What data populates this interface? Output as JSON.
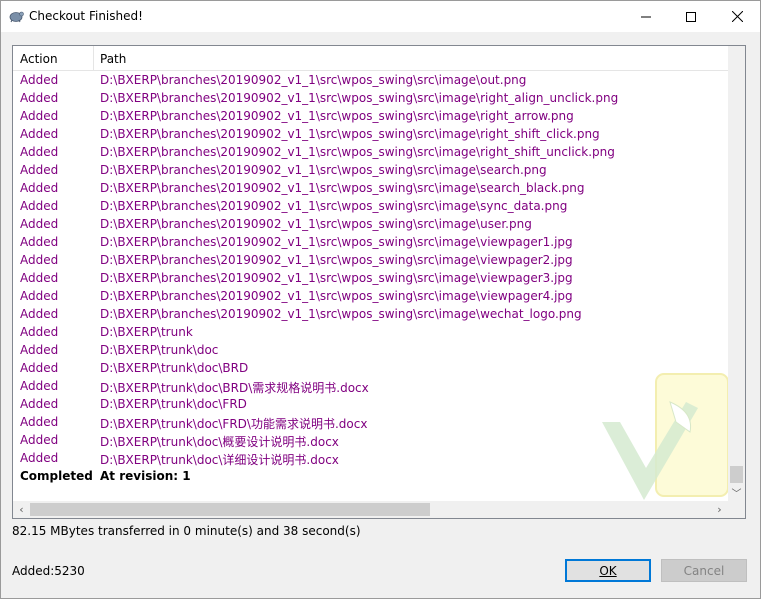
{
  "window": {
    "title": "Checkout Finished!",
    "minimize_glyph": "—",
    "maximize_glyph": "☐",
    "close_glyph": "✕"
  },
  "list": {
    "columns": {
      "action": "Action",
      "path": "Path"
    },
    "rows": [
      {
        "action": "Added",
        "path": "D:\\BXERP\\branches\\20190902_v1_1\\src\\wpos_swing\\src\\image\\out.png"
      },
      {
        "action": "Added",
        "path": "D:\\BXERP\\branches\\20190902_v1_1\\src\\wpos_swing\\src\\image\\right_align_unclick.png"
      },
      {
        "action": "Added",
        "path": "D:\\BXERP\\branches\\20190902_v1_1\\src\\wpos_swing\\src\\image\\right_arrow.png"
      },
      {
        "action": "Added",
        "path": "D:\\BXERP\\branches\\20190902_v1_1\\src\\wpos_swing\\src\\image\\right_shift_click.png"
      },
      {
        "action": "Added",
        "path": "D:\\BXERP\\branches\\20190902_v1_1\\src\\wpos_swing\\src\\image\\right_shift_unclick.png"
      },
      {
        "action": "Added",
        "path": "D:\\BXERP\\branches\\20190902_v1_1\\src\\wpos_swing\\src\\image\\search.png"
      },
      {
        "action": "Added",
        "path": "D:\\BXERP\\branches\\20190902_v1_1\\src\\wpos_swing\\src\\image\\search_black.png"
      },
      {
        "action": "Added",
        "path": "D:\\BXERP\\branches\\20190902_v1_1\\src\\wpos_swing\\src\\image\\sync_data.png"
      },
      {
        "action": "Added",
        "path": "D:\\BXERP\\branches\\20190902_v1_1\\src\\wpos_swing\\src\\image\\user.png"
      },
      {
        "action": "Added",
        "path": "D:\\BXERP\\branches\\20190902_v1_1\\src\\wpos_swing\\src\\image\\viewpager1.jpg"
      },
      {
        "action": "Added",
        "path": "D:\\BXERP\\branches\\20190902_v1_1\\src\\wpos_swing\\src\\image\\viewpager2.jpg"
      },
      {
        "action": "Added",
        "path": "D:\\BXERP\\branches\\20190902_v1_1\\src\\wpos_swing\\src\\image\\viewpager3.jpg"
      },
      {
        "action": "Added",
        "path": "D:\\BXERP\\branches\\20190902_v1_1\\src\\wpos_swing\\src\\image\\viewpager4.jpg"
      },
      {
        "action": "Added",
        "path": "D:\\BXERP\\branches\\20190902_v1_1\\src\\wpos_swing\\src\\image\\wechat_logo.png"
      },
      {
        "action": "Added",
        "path": "D:\\BXERP\\trunk"
      },
      {
        "action": "Added",
        "path": "D:\\BXERP\\trunk\\doc"
      },
      {
        "action": "Added",
        "path": "D:\\BXERP\\trunk\\doc\\BRD"
      },
      {
        "action": "Added",
        "path": "D:\\BXERP\\trunk\\doc\\BRD\\需求规格说明书.docx"
      },
      {
        "action": "Added",
        "path": "D:\\BXERP\\trunk\\doc\\FRD"
      },
      {
        "action": "Added",
        "path": "D:\\BXERP\\trunk\\doc\\FRD\\功能需求说明书.docx"
      },
      {
        "action": "Added",
        "path": "D:\\BXERP\\trunk\\doc\\概要设计说明书.docx"
      },
      {
        "action": "Added",
        "path": "D:\\BXERP\\trunk\\doc\\详细设计说明书.docx"
      }
    ],
    "completed": {
      "action": "Completed",
      "path": "At revision: 1"
    }
  },
  "status": {
    "transfer": "82.15 MBytes transferred in 0 minute(s) and 38 second(s)",
    "added_count": "Added:5230"
  },
  "buttons": {
    "ok": "OK",
    "cancel": "Cancel"
  },
  "colors": {
    "added_text": "#800080",
    "ok_border": "#0078d7"
  }
}
